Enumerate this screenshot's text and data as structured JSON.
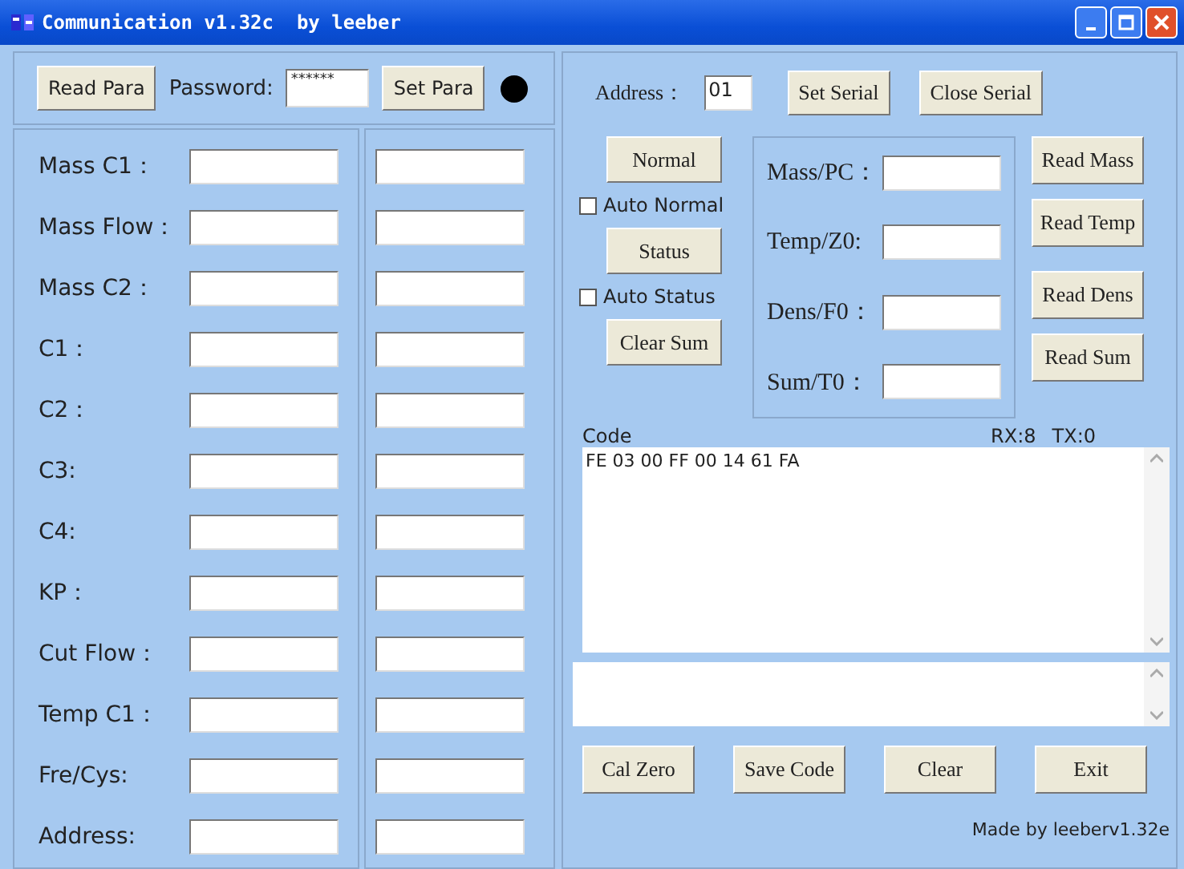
{
  "window": {
    "title": "Communication v1.32c  by leeber"
  },
  "para_bar": {
    "read_button": "Read Para",
    "password_label": "Password:",
    "password_value": "******",
    "set_button": "Set Para",
    "indicator_on": true
  },
  "params": [
    {
      "label": "Mass C1："
    },
    {
      "label": "Mass Flow："
    },
    {
      "label": "Mass C2："
    },
    {
      "label": "C1："
    },
    {
      "label": "C2："
    },
    {
      "label": "C3:"
    },
    {
      "label": "C4:"
    },
    {
      "label": "KP："
    },
    {
      "label": "Cut Flow："
    },
    {
      "label": "Temp C1："
    },
    {
      "label": "Fre/Cys:"
    },
    {
      "label": "Address:"
    }
  ],
  "serial": {
    "address_label": "Address：",
    "address_value": "01",
    "buttons": [
      "Set Serial",
      "Close Serial"
    ]
  },
  "mode_controls": [
    {
      "kind": "button",
      "label": "Normal"
    },
    {
      "kind": "checkbox",
      "label": "Auto Normal",
      "checked": false
    },
    {
      "kind": "button",
      "label": "Status"
    },
    {
      "kind": "checkbox",
      "label": "Auto Status",
      "checked": false
    },
    {
      "kind": "button",
      "label": "Clear Sum"
    }
  ],
  "readings": [
    {
      "label": "Mass/PC：",
      "button": "Read Mass"
    },
    {
      "label": "Temp/Z0:",
      "button": "Read Temp"
    },
    {
      "label": "Dens/F0：",
      "button": "Read Dens"
    },
    {
      "label": "Sum/T0：",
      "button": "Read Sum"
    }
  ],
  "code": {
    "label": "Code",
    "rx": "RX:8",
    "tx": "TX:0",
    "text": "FE 03 00 FF 00 14 61 FA"
  },
  "bottom_buttons": [
    "Cal Zero",
    "Save Code",
    "Clear",
    "Exit"
  ],
  "credit": "Made by leeberv1.32e"
}
